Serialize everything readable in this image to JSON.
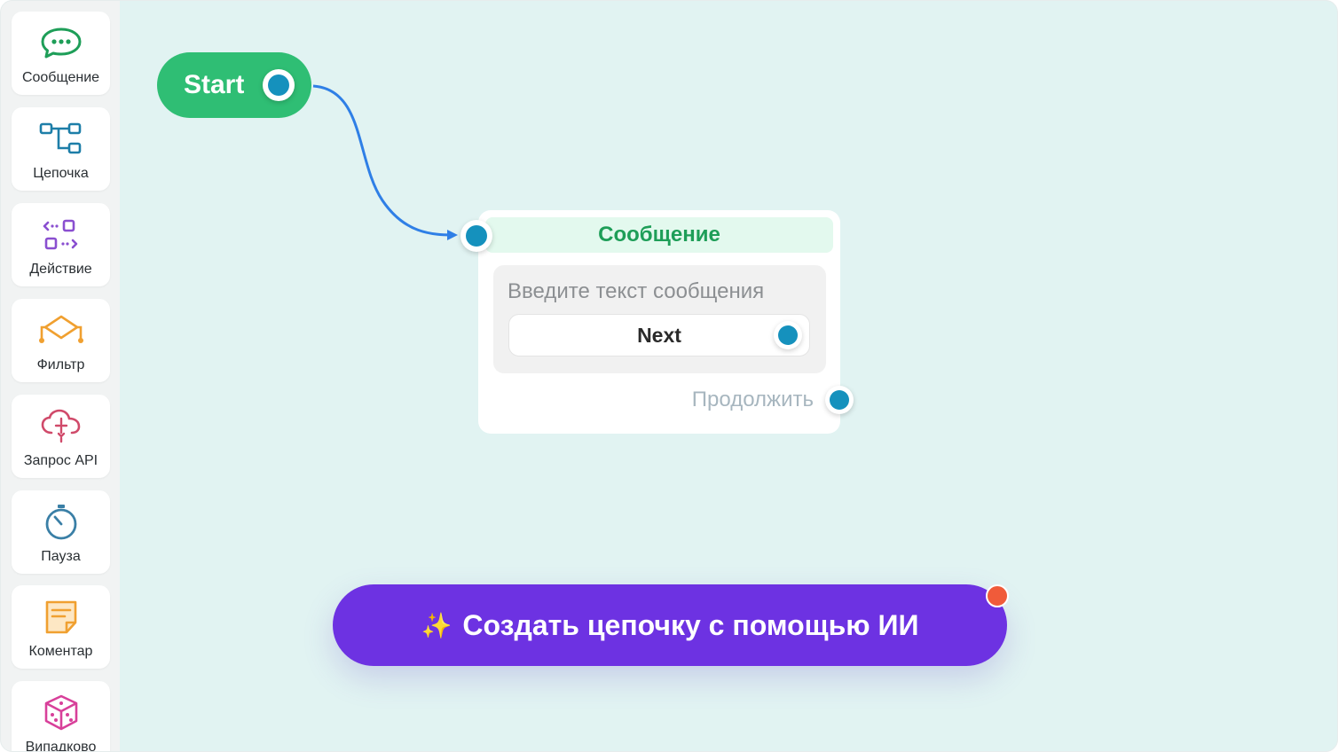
{
  "sidebar": {
    "items": [
      {
        "label": "Сообщение",
        "icon": "chat-bubble-icon",
        "color": "#1e9e58"
      },
      {
        "label": "Цепочка",
        "icon": "chain-flow-icon",
        "color": "#1d7ea8"
      },
      {
        "label": "Действие",
        "icon": "action-icon",
        "color": "#8a4fd0"
      },
      {
        "label": "Фильтр",
        "icon": "filter-branch-icon",
        "color": "#f0a030"
      },
      {
        "label": "Запрос API",
        "icon": "cloud-api-icon",
        "color": "#d04a6a"
      },
      {
        "label": "Пауза",
        "icon": "timer-icon",
        "color": "#3a7fa6"
      },
      {
        "label": "Коментар",
        "icon": "note-icon",
        "color": "#f0a030"
      },
      {
        "label": "Випадково",
        "icon": "dice-icon",
        "color": "#d8409a"
      }
    ]
  },
  "canvas": {
    "start_node": {
      "label": "Start",
      "color": "#2fbe74"
    },
    "message_node": {
      "title": "Сообщение",
      "placeholder": "Введите текст сообщения",
      "button_label": "Next",
      "continue_label": "Продолжить"
    },
    "edge_color": "#2f7fe6"
  },
  "ai_button": {
    "icon": "sparkles-icon",
    "spark": "✨",
    "label": "Создать цепочку с помощью ИИ",
    "color": "#6d32e2"
  }
}
